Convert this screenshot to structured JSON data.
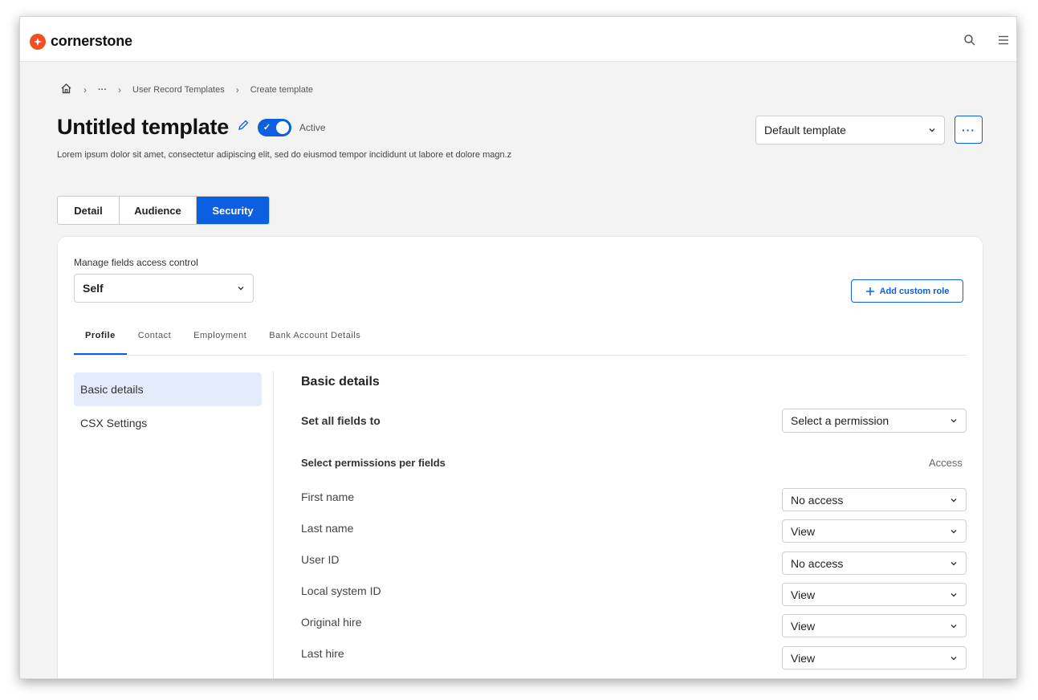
{
  "app": {
    "brand": "cornerstone"
  },
  "icons": {
    "logo": "cornerstone-logo-icon",
    "search": "search-icon",
    "menu": "hamburger-menu-icon",
    "home": "home-icon",
    "edit": "pencil-edit-icon"
  },
  "colors": {
    "accent": "#0b5fe0",
    "brand": "#f04e23",
    "selected_bg": "#e4ecfb"
  },
  "breadcrumb": {
    "ellipsis": "···",
    "items": [
      "User Record Templates",
      "Create template"
    ]
  },
  "header": {
    "title": "Untitled template",
    "toggle_on": true,
    "status": "Active",
    "description": "Lorem ipsum dolor sit amet, consectetur adipiscing elit, sed do eiusmod tempor incididunt ut labore et dolore magn.z",
    "template_select": "Default template",
    "more_label": "···"
  },
  "tabs": [
    {
      "label": "Detail",
      "active": false
    },
    {
      "label": "Audience",
      "active": false
    },
    {
      "label": "Security",
      "active": true
    }
  ],
  "security": {
    "access_control_label": "Manage fields access control",
    "access_control_value": "Self",
    "add_role_label": "Add custom role",
    "subtabs": [
      "Profile",
      "Contact",
      "Employment",
      "Bank Account Details"
    ],
    "active_subtab": "Profile",
    "side_items": [
      "Basic details",
      "CSX Settings"
    ],
    "active_side_item": "Basic details",
    "section_title": "Basic details",
    "set_all_label": "Set all fields to",
    "set_all_placeholder": "Select a permission",
    "per_fields_label": "Select permissions per fields",
    "access_header": "Access",
    "fields": [
      {
        "name": "First name",
        "access": "No access"
      },
      {
        "name": "Last name",
        "access": "View"
      },
      {
        "name": "User ID",
        "access": "No access"
      },
      {
        "name": "Local system ID",
        "access": "View"
      },
      {
        "name": "Original hire",
        "access": "View"
      },
      {
        "name": "Last hire",
        "access": "View"
      }
    ]
  }
}
